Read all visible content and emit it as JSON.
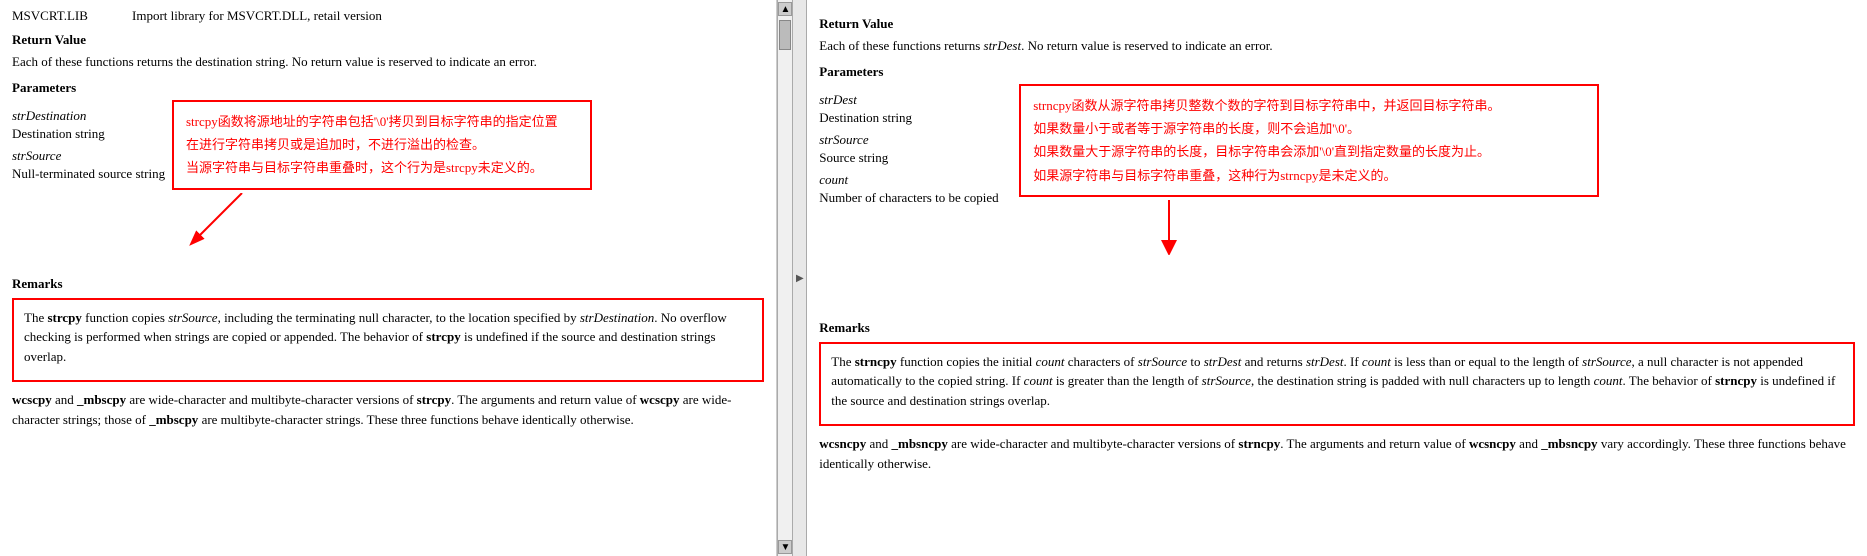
{
  "left": {
    "lib_name": "MSVCRT.LIB",
    "lib_desc": "Import library for MSVCRT.DLL, retail version",
    "return_value_header": "Return Value",
    "return_value_text": "Each of these functions returns the destination string. No return value is reserved to indicate an error.",
    "parameters_header": "Parameters",
    "param1_name": "strDestination",
    "param1_desc": "Destination string",
    "param2_name": "strSource",
    "param2_desc": "Null-terminated source string",
    "remarks_header": "Remarks",
    "tooltip_line1": "strcpy函数将源地址的字符串包括'\\0'拷贝到目标字符串的指定位置",
    "tooltip_line2": "在进行字符串拷贝或是追加时，不进行溢出的检查。",
    "tooltip_line3": "当源字符串与目标字符串重叠时，这个行为是strcpy未定义的。",
    "remarks_text1": "The",
    "remarks_bold1": "strcpy",
    "remarks_text2": "function copies",
    "remarks_italic1": "strSource",
    "remarks_text3": ", including the terminating null character, to the location specified by",
    "remarks_italic2": "strDestination",
    "remarks_text4": ". No overflow checking is performed when strings are copied or appended. The behavior of",
    "remarks_bold2": "strcpy",
    "remarks_text5": "is undefined if the source and destination strings overlap.",
    "remarks_full": "The strcpy function copies strSource, including the terminating null character, to the location specified by strDestination. No overflow checking is performed when strings are copied or appended. The behavior of strcpy is undefined if the source and destination strings overlap.",
    "wcs_text": "wcscpy and _mbscpy are wide-character and multibyte-character versions of strcpy. The arguments and return value of wcscpy are wide-character strings; those of _mbscpy are multibyte-character strings. These three functions behave identically otherwise."
  },
  "right": {
    "return_value_header": "Return Value",
    "return_value_text": "Each of these functions returns strDest. No return value is reserved to indicate an error.",
    "parameters_header": "Parameters",
    "param1_name": "strDest",
    "tooltip_line1": "strncpy函数从源字符串拷贝整数个数的字符到目标字符串中，并返回目标字符串。",
    "tooltip_line2": "如果数量小于或者等于源字符串的长度，则不会追加'\\0'。",
    "tooltip_line3": "如果数量大于源字符串的长度，目标字符串会添加'\\0'直到指定数量的长度为止。",
    "tooltip_line4": "如果源字符串与目标字符串重叠，这种行为strncpy是未定义的。",
    "param2_label": "Destination string",
    "param3_name": "strSource",
    "param4_label": "Source string",
    "param5_name": "count",
    "param6_label": "Number of characters to be copied",
    "remarks_header": "Remarks",
    "remarks_full": "The strncpy function copies the initial count characters of strSource to strDest and returns strDest. If count is less than or equal to the length of strSource, a null character is not appended automatically to the copied string. If count is greater than the length of strSource, the destination string is padded with null characters up to length count. The behavior of strncpy is undefined if the source and destination strings overlap.",
    "wcs_text": "wcsncpy and _mbsncpy are wide-character and multibyte-character versions of strncpy. The arguments and return value of wcsncpy and _mbsncpy vary accordingly. These three functions behave identically otherwise."
  }
}
